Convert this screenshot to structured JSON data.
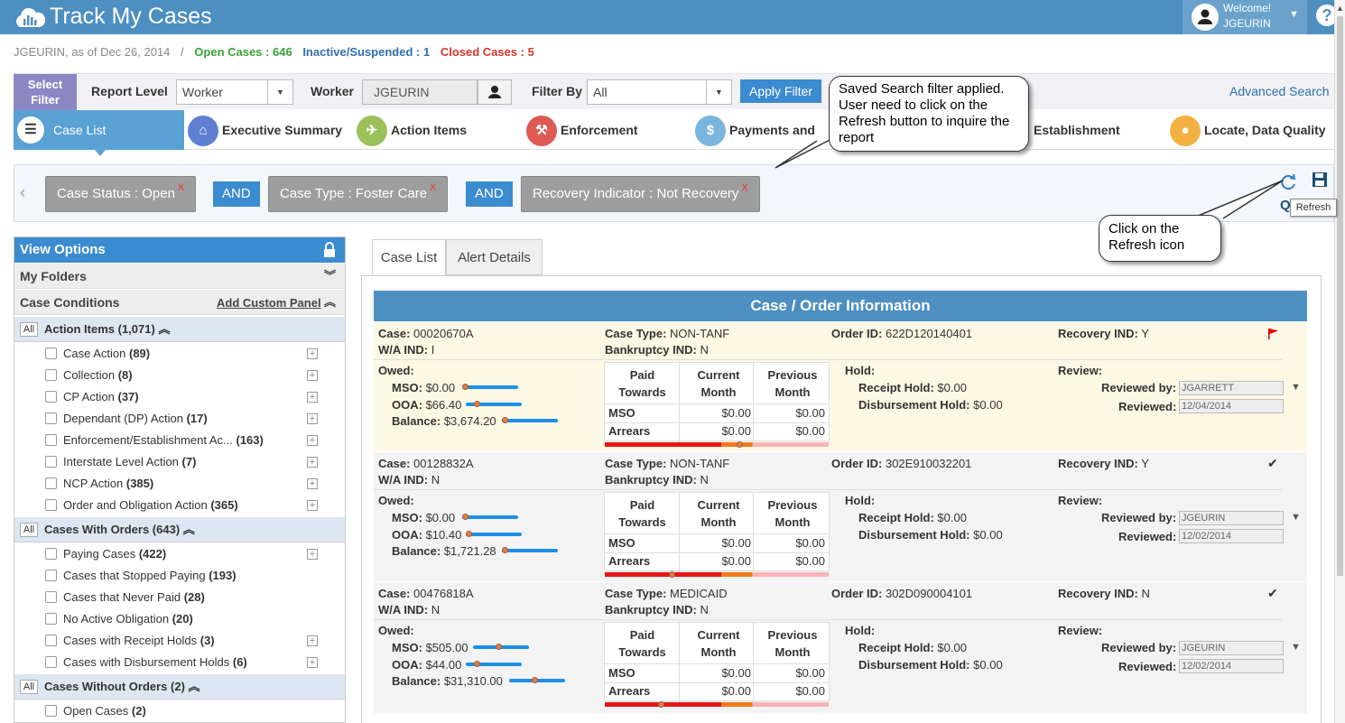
{
  "header": {
    "title": "Track My Cases",
    "welcome": "Welcome!",
    "user": "JGEURIN"
  },
  "subheader": {
    "as_of": "JGEURIN, as of Dec 26, 2014",
    "sep": "/",
    "open": "Open Cases : 646",
    "inactive": "Inactive/Suspended : 1",
    "closed": "Closed Cases : 5"
  },
  "filter": {
    "select_filter": "Select Filter",
    "report_level_label": "Report Level",
    "report_level_value": "Worker",
    "worker_label": "Worker",
    "worker_value": "JGEURIN",
    "filter_by_label": "Filter By",
    "filter_by_value": "All",
    "apply": "Apply Filter",
    "advanced": "Advanced Search"
  },
  "tabs": [
    {
      "label": "Case List",
      "color": "#5aa1d4"
    },
    {
      "label": "Executive Summary",
      "color": "#5f7fd3"
    },
    {
      "label": "Action Items",
      "color": "#9bc25a"
    },
    {
      "label": "Enforcement",
      "color": "#df5a55"
    },
    {
      "label": "Payments and",
      "color": "#7ab5de"
    },
    {
      "label": "Establishment",
      "color": "#ffffff"
    },
    {
      "label": "Locate, Data Quality",
      "color": "#f4b143"
    }
  ],
  "criteria": {
    "chips": [
      {
        "label": "Case Status :  Open",
        "x": "X"
      },
      {
        "label": "Case Type :  Foster Care",
        "x": "X"
      },
      {
        "label": "Recovery Indicator :  Not Recovery",
        "x": "X"
      }
    ],
    "and": "AND"
  },
  "callouts": {
    "saved": "Saved Search filter applied. User need to click on the Refresh button to inquire the report",
    "refresh_click": "Click on the Refresh icon",
    "refresh_tooltip": "Refresh"
  },
  "left_panel": {
    "view_options": "View Options",
    "my_folders": "My Folders",
    "case_conditions": "Case Conditions",
    "add_custom": "Add Custom Panel",
    "all": "All",
    "groups": [
      {
        "label": "Action Items (1,071)",
        "items": [
          {
            "label": "Case Action",
            "count": "(89)"
          },
          {
            "label": "Collection",
            "count": "(8)"
          },
          {
            "label": "CP Action",
            "count": "(37)"
          },
          {
            "label": "Dependant (DP) Action",
            "count": "(17)"
          },
          {
            "label": "Enforcement/Establishment Ac...",
            "count": "(163)"
          },
          {
            "label": "Interstate Level Action",
            "count": "(7)"
          },
          {
            "label": "NCP Action",
            "count": "(385)"
          },
          {
            "label": "Order and Obligation Action",
            "count": "(365)"
          }
        ]
      },
      {
        "label": "Cases With Orders (643)",
        "items": [
          {
            "label": "Paying Cases",
            "count": "(422)"
          },
          {
            "label": "Cases that Stopped Paying",
            "count": "(193)"
          },
          {
            "label": "Cases that Never Paid",
            "count": "(28)"
          },
          {
            "label": "No Active Obligation",
            "count": "(20)"
          },
          {
            "label": "Cases with Receipt Holds",
            "count": "(3)"
          },
          {
            "label": "Cases with Disbursement Holds",
            "count": "(6)"
          }
        ]
      },
      {
        "label": "Cases Without Orders (2)",
        "items": [
          {
            "label": "Open Cases",
            "count": "(2)"
          }
        ]
      }
    ]
  },
  "content": {
    "tab_case_list": "Case List",
    "tab_alert": "Alert Details",
    "co_header": "Case / Order Information",
    "labels": {
      "case": "Case:",
      "wa": "W/A IND:",
      "case_type": "Case Type:",
      "bankruptcy": "Bankruptcy IND:",
      "order_id": "Order ID:",
      "recovery": "Recovery IND:",
      "owed": "Owed:",
      "mso": "MSO:",
      "ooa": "OOA:",
      "balance": "Balance:",
      "paid_towards": "Paid Towards",
      "current_month": "Current Month",
      "previous_month": "Previous Month",
      "mso_row": "MSO",
      "arrears_row": "Arrears",
      "hold": "Hold:",
      "receipt_hold": "Receipt Hold:",
      "disb_hold": "Disbursement Hold:",
      "review": "Review:",
      "reviewed_by": "Reviewed by:",
      "reviewed": "Reviewed:"
    },
    "cases": [
      {
        "case": "00020670A",
        "wa": "I",
        "type": "NON-TANF",
        "bankruptcy": "N",
        "order": "622D120140401",
        "recovery": "Y",
        "mso": "$0.00",
        "ooa": "$66.40",
        "balance": "$3,674.20",
        "mso_cur": "$0.00",
        "mso_prev": "$0.00",
        "arr_cur": "$0.00",
        "arr_prev": "$0.00",
        "receipt_hold": "$0.00",
        "disb_hold": "$0.00",
        "reviewed_by": "JGARRETT",
        "reviewed": "12/04/2014",
        "flag": "flag-icon"
      },
      {
        "case": "00128832A",
        "wa": "N",
        "type": "NON-TANF",
        "bankruptcy": "N",
        "order": "302E910032201",
        "recovery": "Y",
        "mso": "$0.00",
        "ooa": "$10.40",
        "balance": "$1,721.28",
        "mso_cur": "$0.00",
        "mso_prev": "$0.00",
        "arr_cur": "$0.00",
        "arr_prev": "$0.00",
        "receipt_hold": "$0.00",
        "disb_hold": "$0.00",
        "reviewed_by": "JGEURIN",
        "reviewed": "12/02/2014",
        "flag": "check-icon"
      },
      {
        "case": "00476818A",
        "wa": "N",
        "type": "MEDICAID",
        "bankruptcy": "N",
        "order": "302D090004101",
        "recovery": "N",
        "mso": "$505.00",
        "ooa": "$44.00",
        "balance": "$31,310.00",
        "mso_cur": "$0.00",
        "mso_prev": "$0.00",
        "arr_cur": "$0.00",
        "arr_prev": "$0.00",
        "receipt_hold": "$0.00",
        "disb_hold": "$0.00",
        "reviewed_by": "JGEURIN",
        "reviewed": "12/02/2014",
        "flag": "check-icon"
      }
    ]
  },
  "colors": {
    "header": "#4d8fc0",
    "accent": "#3b8bd0",
    "open": "#3aa23a",
    "inactive": "#2e6fb0",
    "closed": "#d9342b"
  }
}
